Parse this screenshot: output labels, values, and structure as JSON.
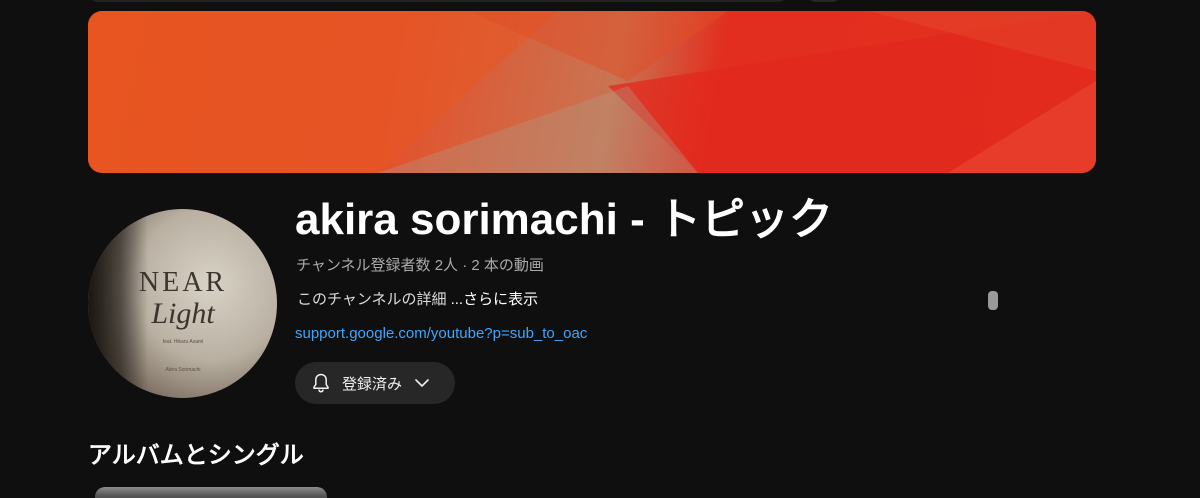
{
  "channel": {
    "title": "akira sorimachi - トピック",
    "meta": "チャンネル登録者数 2人 · 2 本の動画",
    "description": "このチャンネルの詳細",
    "more_label": "...さらに表示",
    "link": "support.google.com/youtube?p=sub_to_oac",
    "avatar_art": {
      "line1": "NEAR",
      "line2": "Light",
      "line3": "feat. Hikaru Asami",
      "line4": "Akira Sorimachi"
    }
  },
  "subscribe_button": {
    "label": "登録済み",
    "icon": "bell-icon"
  },
  "sections": {
    "albums_title": "アルバムとシングル"
  },
  "colors": {
    "background": "#0f0f0f",
    "banner_primary": "#e22e1e",
    "link": "#3ea6ff",
    "button_bg": "#272727"
  }
}
